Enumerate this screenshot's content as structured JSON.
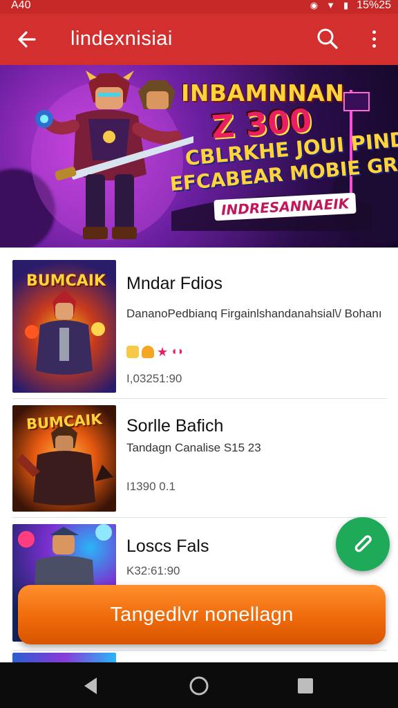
{
  "status_bar": {
    "time": "A40",
    "battery": "15%25"
  },
  "app_bar": {
    "title": "lindexnisiai"
  },
  "banner": {
    "headline": "INBAMNNAN",
    "big_number": "Z 300",
    "line1": "CBLRKHE JOUI PINDA!",
    "line2": "EFCABEAR MOBIE GROKKE",
    "pill": "INDRESANNAEIK"
  },
  "items": [
    {
      "title": "Mndar Fdios",
      "subtitle": "DananoPedbianq Firgainlshandanahsial\\/ Bohanı",
      "meta": "I,03251:90",
      "thumb_title": "BUMCAIK",
      "thumb_colors": [
        "#2b1c6b",
        "#c83a1c",
        "#f5b21a"
      ]
    },
    {
      "title": "Sorlle Bafich",
      "subtitle": "Tandagn Canalise S15 23",
      "meta": "I1390 0.1",
      "thumb_title": "BUMCAIK",
      "thumb_colors": [
        "#3a1406",
        "#e65a10",
        "#ffb347"
      ]
    },
    {
      "title": "Loscs Fals",
      "subtitle": "",
      "meta": "K32:61:90",
      "thumb_title": "",
      "thumb_colors": [
        "#13235f",
        "#7b2fd0",
        "#29b6f6"
      ]
    }
  ],
  "cta": {
    "label": "Tangedlvr nonellagn"
  },
  "colors": {
    "app_bar": "#d32f2f",
    "fab": "#1faa59",
    "cta": "#ef6a0a"
  }
}
